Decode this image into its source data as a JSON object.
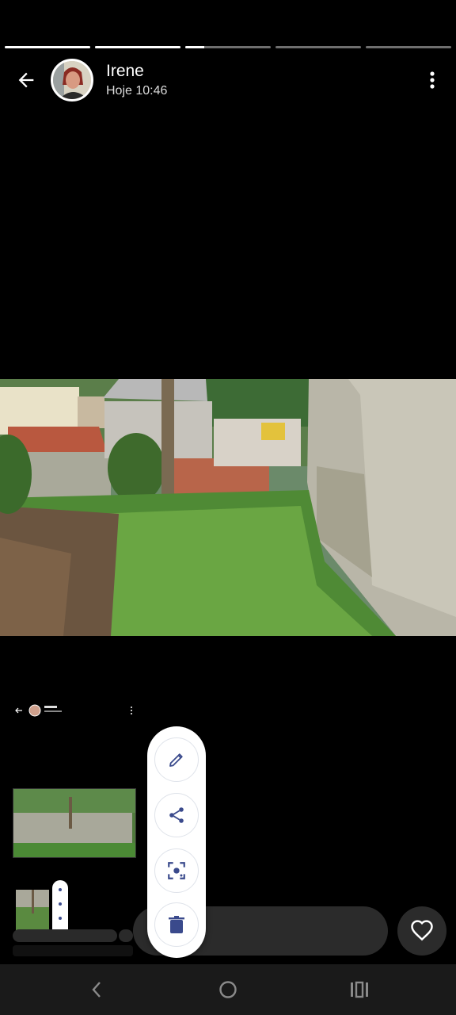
{
  "story": {
    "segments": [
      {
        "progress": 1.0
      },
      {
        "progress": 1.0
      },
      {
        "progress": 0.22
      },
      {
        "progress": 0.0
      },
      {
        "progress": 0.0
      }
    ]
  },
  "header": {
    "user_name": "Irene",
    "timestamp": "Hoje 10:46",
    "back_icon": "arrow-left-icon",
    "menu_icon": "more-vertical-icon"
  },
  "actions": [
    {
      "icon": "pencil-icon"
    },
    {
      "icon": "share-icon"
    },
    {
      "icon": "lens-scan-icon"
    },
    {
      "icon": "trash-icon"
    }
  ],
  "colors": {
    "accent": "#3a4a8c",
    "background": "#000000",
    "bar": "#2b2b2b"
  }
}
